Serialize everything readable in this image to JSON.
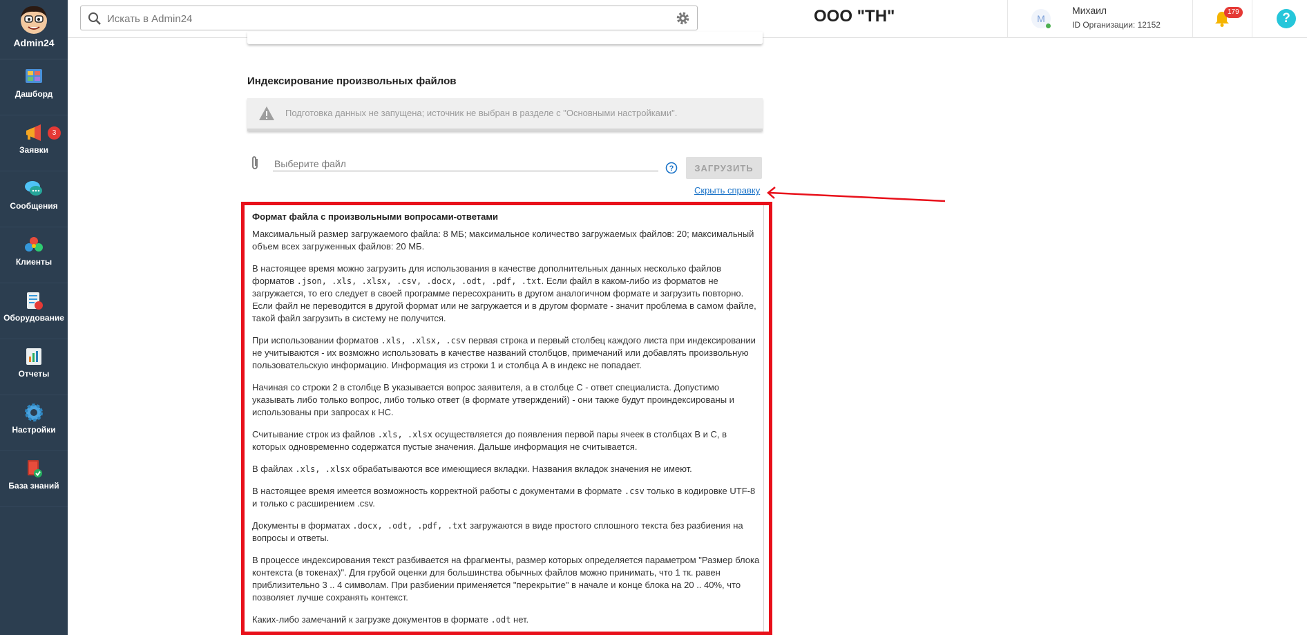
{
  "brand": {
    "name": "Admin24"
  },
  "sidebar": {
    "items": [
      {
        "label": "Дашборд",
        "icon": "dashboard-icon"
      },
      {
        "label": "Заявки",
        "icon": "megaphone-icon",
        "badge": "3"
      },
      {
        "label": "Сообщения",
        "icon": "chat-bubbles-icon"
      },
      {
        "label": "Клиенты",
        "icon": "clients-icon"
      },
      {
        "label": "Оборудование",
        "icon": "equipment-icon"
      },
      {
        "label": "Отчеты",
        "icon": "reports-icon"
      },
      {
        "label": "Настройки",
        "icon": "gear-icon"
      },
      {
        "label": "База знаний",
        "icon": "knowledge-base-icon"
      }
    ]
  },
  "header": {
    "search_placeholder": "Искать в Admin24",
    "org_name": "ООО \"ТН\"",
    "user": {
      "initial": "М",
      "name": "Михаил",
      "org_id": "ID Организации: 12152"
    },
    "notifications_count": "179",
    "help_label": "?"
  },
  "main": {
    "section_title": "Индексирование произвольных файлов",
    "warning_text": "Подготовка данных не запущена; источник не выбран в разделе с \"Основными настройками\".",
    "file_placeholder": "Выберите файл",
    "upload_label": "ЗАГРУЗИТЬ",
    "hide_help_label": "Скрыть справку"
  },
  "help": {
    "title": "Формат файла с произвольными вопросами-ответами",
    "p1": "Максимальный размер загружаемого файла: 8 МБ; максимальное количество загружаемых файлов: 20; максимальный объем всех загруженных файлов: 20 МБ.",
    "p2_a": "В настоящее время можно загрузить для использования в качестве дополнительных данных несколько файлов форматов ",
    "p2_code": ".json, .xls, .xlsx, .csv, .docx, .odt, .pdf, .txt",
    "p2_b": ". Если файл в каком-либо из форматов не загружается, то его следует в своей программе пересохранить в другом аналогичном формате и загрузить повторно. Если файл не переводится в другой формат или не загружается и в другом формате - значит проблема в самом файле, такой файл загрузить в систему не получится.",
    "p3_a": "При использовании форматов ",
    "p3_code": ".xls, .xlsx, .csv",
    "p3_b": " первая строка и первый столбец каждого листа при индексировании не учитываются - их возможно использовать в качестве названий столбцов, примечаний или добавлять произвольную пользовательскую информацию. Информация из строки 1 и столбца А в индекс не попадает.",
    "p4": "Начиная со строки 2 в столбце В указывается вопрос заявителя, а в столбце С - ответ специалиста. Допустимо указывать либо только вопрос, либо только ответ (в формате утверждений) - они также будут проиндексированы и использованы при запросах к НС.",
    "p5_a": "Считывание строк из файлов ",
    "p5_code": ".xls, .xlsx",
    "p5_b": " осуществляется до появления первой пары ячеек в столбцах В и С, в которых одновременно содержатся пустые значения. Дальше информация не считывается.",
    "p6_a": "В файлах ",
    "p6_code": ".xls, .xlsx",
    "p6_b": " обрабатываются все имеющиеся вкладки. Названия вкладок значения не имеют.",
    "p7_a": "В настоящее время имеется возможность корректной работы с документами в формате ",
    "p7_code": ".csv",
    "p7_b": " только в кодировке UTF-8 и только с расширением .csv.",
    "p8_a": "Документы в форматах ",
    "p8_code": ".docx, .odt, .pdf, .txt",
    "p8_b": " загружаются в виде простого сплошного текста без разбиения на вопросы и ответы.",
    "p9": "В процессе индексирования текст разбивается на фрагменты, размер которых определяется параметром \"Размер блока контекста (в токенах)\". Для грубой оценки для большинства обычных файлов можно принимать, что 1 тк. равен приблизительно 3 .. 4 символам. При разбиении применяется \"перекрытие\" в начале и конце блока на 20 .. 40%, что позволяет лучше сохранять контекст.",
    "p10_a": "Каких-либо замечаний к загрузке документов в формате ",
    "p10_code": ".odt",
    "p10_b": " нет."
  },
  "colors": {
    "sidebar_bg": "#2c3e50",
    "highlight_red": "#e8101a",
    "link": "#1a73c8",
    "badge": "#e53935"
  }
}
